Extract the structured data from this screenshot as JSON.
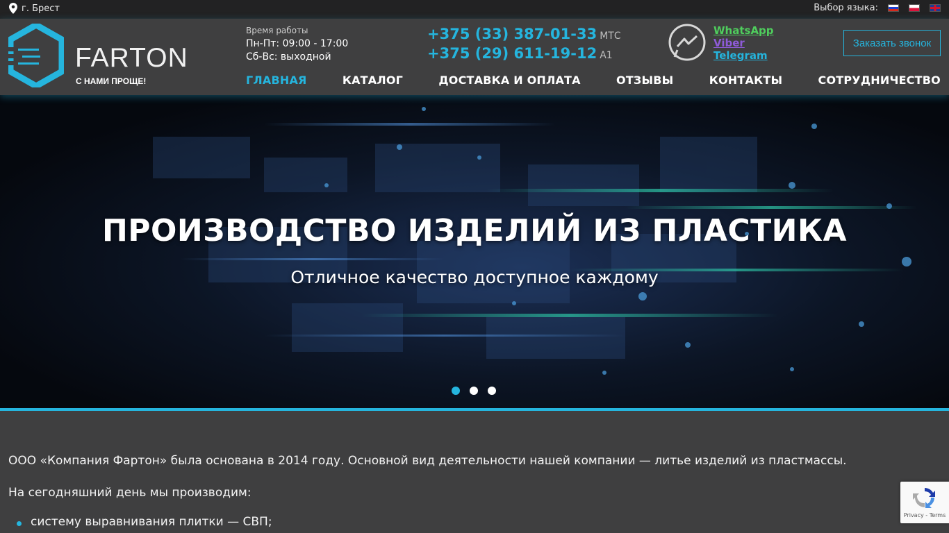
{
  "topbar": {
    "city": "г. Брест",
    "lang_label": "Выбор языка:",
    "languages": [
      {
        "code": "ru",
        "icon": "flag-ru-icon"
      },
      {
        "code": "pl",
        "icon": "flag-pl-icon"
      },
      {
        "code": "en",
        "icon": "flag-en-icon"
      }
    ]
  },
  "header": {
    "logo_name": "FARTON",
    "logo_tagline": "С НАМИ ПРОЩЕ!",
    "hours_caption": "Время работы",
    "hours_weekdays": "Пн-Пт: 09:00 - 17:00",
    "hours_weekend": "Сб-Вс: выходной",
    "phones": [
      {
        "number": "+375 (33) 387-01-33",
        "operator": "МТС"
      },
      {
        "number": "+375 (29) 611-19-12",
        "operator": "А1"
      }
    ],
    "messengers": {
      "whatsapp": "WhatsApp",
      "viber": "Viber",
      "telegram": "Telegram"
    },
    "callback_button": "Заказать звонок"
  },
  "nav": {
    "items": [
      "ГЛАВНАЯ",
      "КАТАЛОГ",
      "ДОСТАВКА И ОПЛАТА",
      "ОТЗЫВЫ",
      "КОНТАКТЫ",
      "СОТРУДНИЧЕСТВО"
    ],
    "active_index": 0
  },
  "hero": {
    "title": "ПРОИЗВОДСТВО ИЗДЕЛИЙ ИЗ ПЛАСТИКА",
    "subtitle": "Отличное качество доступное каждому",
    "slide_count": 3,
    "active_slide": 0
  },
  "content": {
    "intro": "ООО «Компания Фартон» была основана в 2014 году. Основной вид деятельности нашей компании — литье изделий из пластмассы.",
    "produce_heading": "На сегодняшний день мы производим:",
    "products": [
      "систему выравнивания плитки — СВП;"
    ]
  },
  "recaptcha": {
    "text": "Privacy - Terms"
  },
  "colors": {
    "accent": "#25b5de",
    "header_bg": "#3f3f40",
    "topbar_bg": "#222223",
    "whatsapp": "#4fce5d",
    "viber": "#8e5bd8"
  }
}
